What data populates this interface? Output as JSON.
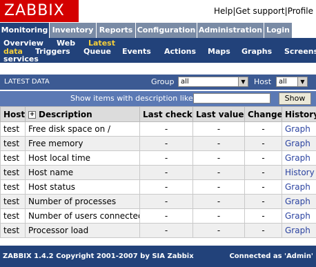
{
  "header": {
    "logo": "ZABBIX",
    "links": [
      "Help",
      "Get support",
      "Profile"
    ]
  },
  "main_menu": [
    "Monitoring",
    "Inventory",
    "Reports",
    "Configuration",
    "Administration",
    "Login"
  ],
  "sub_menu": {
    "overview": "Overview",
    "web": "Web",
    "latest_line1": "Latest",
    "latest_line2": "data",
    "triggers": "Triggers",
    "queue": "Queue",
    "events": "Events",
    "actions": "Actions",
    "maps": "Maps",
    "graphs": "Graphs",
    "screens": "Screens",
    "services": "services"
  },
  "titlebar": {
    "title": "LATEST DATA",
    "group_label": "Group",
    "group_value": "all",
    "host_label": "Host",
    "host_value": "all"
  },
  "filter": {
    "label": "Show items with description like",
    "value": "",
    "button": "Show"
  },
  "table": {
    "headers": [
      "Host",
      "Description",
      "Last check",
      "Last value",
      "Change",
      "History"
    ],
    "rows": [
      {
        "host": "test",
        "description": "Free disk space on /",
        "last_check": "-",
        "last_value": "-",
        "change": "-",
        "history": "Graph"
      },
      {
        "host": "test",
        "description": "Free memory",
        "last_check": "-",
        "last_value": "-",
        "change": "-",
        "history": "Graph"
      },
      {
        "host": "test",
        "description": "Host local time",
        "last_check": "-",
        "last_value": "-",
        "change": "-",
        "history": "Graph"
      },
      {
        "host": "test",
        "description": "Host name",
        "last_check": "-",
        "last_value": "-",
        "change": "-",
        "history": "History"
      },
      {
        "host": "test",
        "description": "Host status",
        "last_check": "-",
        "last_value": "-",
        "change": "-",
        "history": "Graph"
      },
      {
        "host": "test",
        "description": "Number of processes",
        "last_check": "-",
        "last_value": "-",
        "change": "-",
        "history": "Graph"
      },
      {
        "host": "test",
        "description": "Number of users connected",
        "last_check": "-",
        "last_value": "-",
        "change": "-",
        "history": "Graph"
      },
      {
        "host": "test",
        "description": "Processor load",
        "last_check": "-",
        "last_value": "-",
        "change": "-",
        "history": "Graph"
      }
    ]
  },
  "footer": {
    "copyright": "ZABBIX 1.4.2 Copyright 2001-2007 by  SIA Zabbix",
    "connected": "Connected as 'Admin'"
  },
  "colors": {
    "logo_red": "#d40000",
    "menu_dark": "#22427a",
    "menu_light": "#7a8ba5",
    "highlight_yellow": "#f5cf3a",
    "link_blue": "#2b43a1"
  }
}
